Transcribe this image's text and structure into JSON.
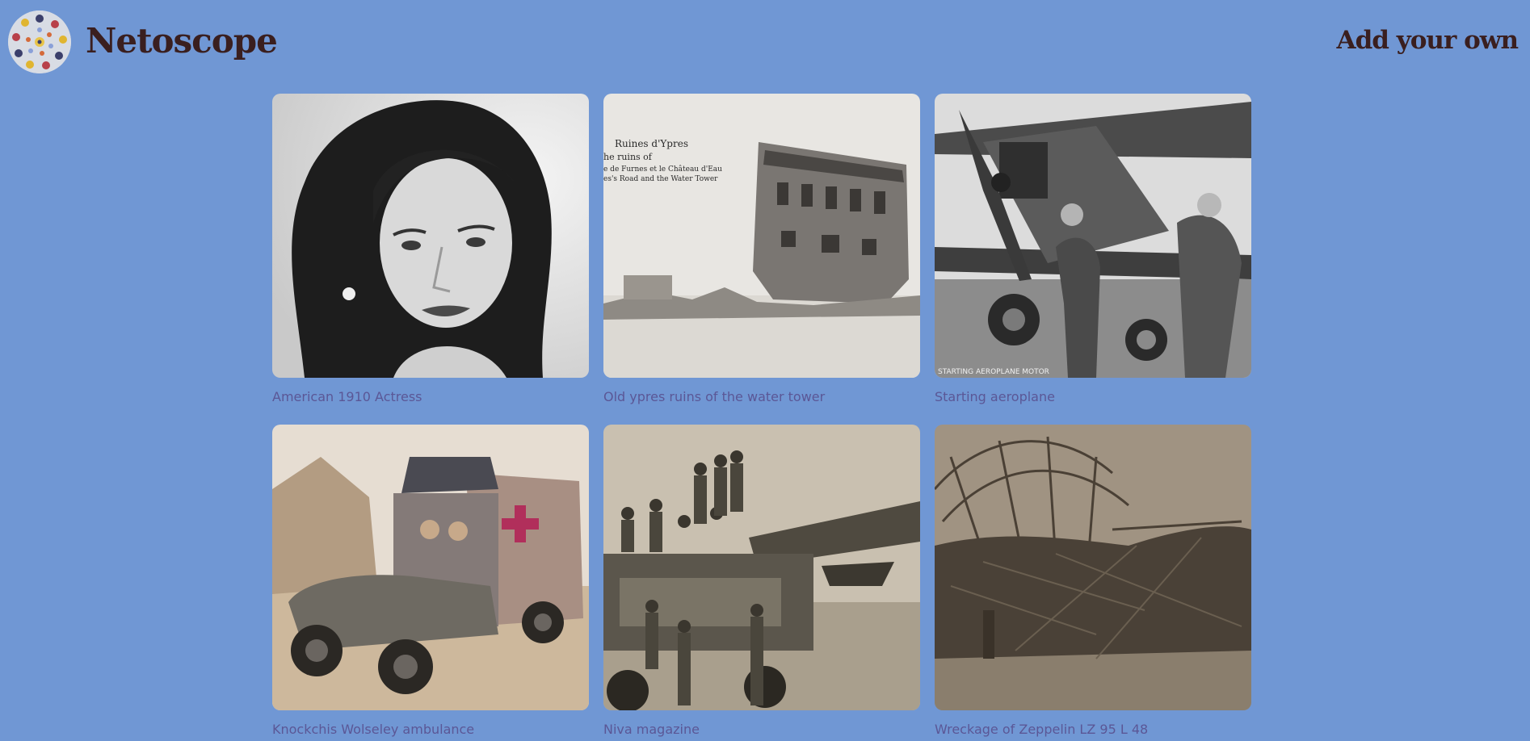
{
  "header": {
    "brand": "Netoscope",
    "add_link": "Add your own"
  },
  "gallery": [
    {
      "caption": "American 1910 Actress",
      "photo_overlay_text": ""
    },
    {
      "caption": "Old ypres ruins of the water tower",
      "photo_overlay_text": "Ruines d'Ypres",
      "photo_overlay_line2": "he ruins of",
      "photo_overlay_line3": "e de Furnes et le Château d'Eau",
      "photo_overlay_line4": "es's Road and the Water Tower"
    },
    {
      "caption": "Starting aeroplane",
      "photo_overlay_text": "STARTING AEROPLANE MOTOR"
    },
    {
      "caption": "Knockchis Wolseley ambulance",
      "photo_overlay_text": ""
    },
    {
      "caption": "Niva magazine",
      "photo_overlay_text": ""
    },
    {
      "caption": "Wreckage of Zeppelin LZ 95 L 48",
      "photo_overlay_text": ""
    }
  ]
}
